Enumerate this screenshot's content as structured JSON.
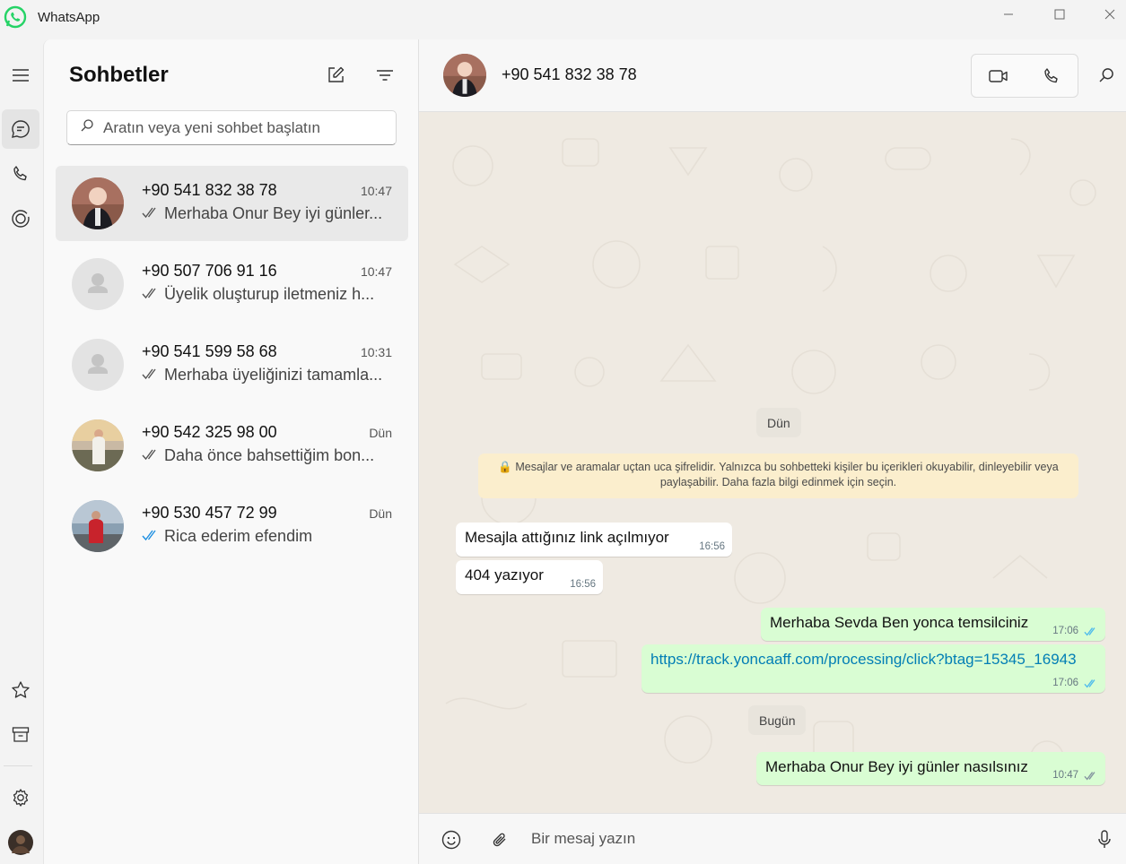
{
  "window": {
    "title": "WhatsApp"
  },
  "sidebar": {
    "heading": "Sohbetler",
    "search_placeholder": "Aratın veya yeni sohbet başlatın",
    "chats": [
      {
        "name": "+90 541 832 38 78",
        "time": "10:47",
        "preview": "Merhaba Onur Bey iyi günler...",
        "tick": "double-grey",
        "active": true
      },
      {
        "name": "+90 507 706 91 16",
        "time": "10:47",
        "preview": "Üyelik oluşturup iletmeniz h...",
        "tick": "double-grey",
        "active": false
      },
      {
        "name": "+90 541 599 58 68",
        "time": "10:31",
        "preview": "Merhaba üyeliğinizi tamamla...",
        "tick": "double-grey",
        "active": false
      },
      {
        "name": "+90 542 325 98 00",
        "time": "Dün",
        "preview": "Daha önce bahsettiğim bon...",
        "tick": "double-grey",
        "active": false
      },
      {
        "name": "+90 530 457 72 99",
        "time": "Dün",
        "preview": "Rica ederim efendim",
        "tick": "double-blue",
        "active": false
      }
    ]
  },
  "conversation": {
    "contact_name": "+90 541 832 38 78",
    "day_yesterday": "Dün",
    "encryption_notice": "🔒 Mesajlar ve aramalar uçtan uca şifrelidir. Yalnızca bu sohbetteki kişiler bu içerikleri okuyabilir, dinleyebilir veya paylaşabilir. Daha fazla bilgi edinmek için seçin.",
    "messages_yesterday": [
      {
        "direction": "in",
        "text": "Mesajla attığınız link açılmıyor",
        "time": "16:56"
      },
      {
        "direction": "in",
        "text": "404 yazıyor",
        "time": "16:56"
      },
      {
        "direction": "out",
        "text": "Merhaba Sevda Ben yonca temsilciniz",
        "time": "17:06",
        "tick": "double-blue"
      },
      {
        "direction": "out",
        "text": "https://track.yoncaaff.com/processing/click?btag=15345_16943",
        "time": "17:06",
        "tick": "double-blue",
        "is_link": true
      }
    ],
    "day_today": "Bugün",
    "messages_today": [
      {
        "direction": "out",
        "text": "Merhaba Onur Bey iyi günler nasılsınız",
        "time": "10:47",
        "tick": "double-grey"
      }
    ]
  },
  "composer": {
    "placeholder": "Bir mesaj yazın"
  },
  "colors": {
    "brand": "#25d366",
    "read_tick": "#53bdeb",
    "outgoing_bubble": "#d9fdd3",
    "chat_background": "#efeae2",
    "notice_background": "#fbeecd"
  }
}
